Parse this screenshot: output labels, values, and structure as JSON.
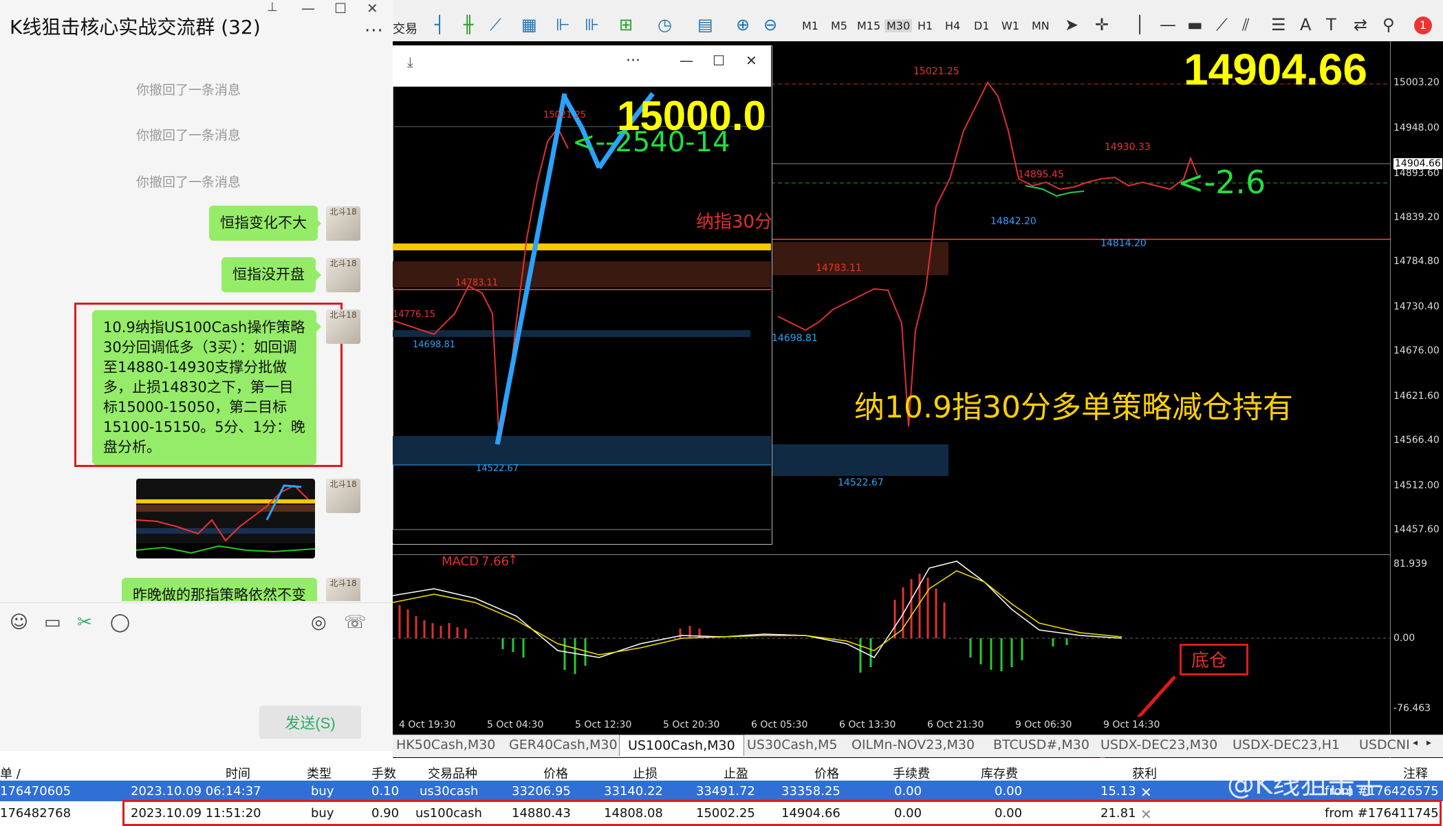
{
  "chat": {
    "title": "K线狙击核心实战交流群 (32)",
    "recalls": [
      "你撤回了一条消息",
      "你撤回了一条消息",
      "你撤回了一条消息"
    ],
    "messages": [
      "恒指变化不大",
      "恒指没开盘",
      "10.9纳指US100Cash操作策略30分回调低多（3买）：如回调至14880-14930支撑分批做多，止损14830之下，第一目标15000-15050，第二目标15100-15150。5分、1分：晚盘分析。",
      "昨晚做的那指策略依然不变"
    ],
    "avatar_text": "北斗18",
    "send_label": "发送(S)"
  },
  "platform": {
    "menu_trade": "交易",
    "timeframes": [
      "M1",
      "M5",
      "M15",
      "M30",
      "H1",
      "H4",
      "D1",
      "W1",
      "MN"
    ],
    "notify_count": "1",
    "big_price": "14904.66",
    "inner_big": "15000.0",
    "inner_arrow": "<--2540-14",
    "inner_label": "纳指30分",
    "arrow_label": "<-2.6",
    "strategy_text": "纳10.9指30分多单策略减仓持有",
    "bottom_label": "底仓",
    "macd_label": "MACD",
    "macd_value": "7.66",
    "chart_marks": {
      "high": "15021.25",
      "p1": "14930.33",
      "p2": "14895.45",
      "p3": "14842.20",
      "p4": "14814.20",
      "p5": "14783.11",
      "p6": "14698.81",
      "p7": "14522.67",
      "inner_high": "15021.25",
      "inner_p5": "14783.11",
      "inner_p6": "14698.81",
      "inner_p7": "14522.67",
      "inner_p8": "14776.15"
    },
    "price_ticks": [
      "15003.20",
      "14948.00",
      "14904.66",
      "14893.60",
      "14839.20",
      "14784.80",
      "14730.40",
      "14676.00",
      "14621.60",
      "14566.40",
      "14512.00",
      "14457.60"
    ],
    "macd_ticks": [
      "81.939",
      "0.00",
      "-76.463"
    ],
    "time_ticks": [
      "4 Oct 19:30",
      "5 Oct 04:30",
      "5 Oct 12:30",
      "5 Oct 20:30",
      "6 Oct 05:30",
      "6 Oct 13:30",
      "6 Oct 21:30",
      "9 Oct 06:30",
      "9 Oct 14:30"
    ],
    "symbol_tabs": [
      "HK50Cash,M30",
      "GER40Cash,M30",
      "US100Cash,M30",
      "US30Cash,M5",
      "OILMn-NOV23,M30",
      "BTCUSD#,M30",
      "USDX-DEC23,M30",
      "USDX-DEC23,H1",
      "USDCNI"
    ],
    "active_tab": "US100Cash,M30"
  },
  "orders": {
    "headers": [
      "单 /",
      "时间",
      "类型",
      "手数",
      "交易品种",
      "价格",
      "止损",
      "止盈",
      "价格",
      "手续费",
      "库存费",
      "获利",
      "注释"
    ],
    "rows": [
      [
        "176470605",
        "2023.10.09 06:14:37",
        "buy",
        "0.10",
        "us30cash",
        "33206.95",
        "33140.22",
        "33491.72",
        "33358.25",
        "0.00",
        "0.00",
        "15.13",
        "from #176426575"
      ],
      [
        "176482768",
        "2023.10.09 11:51:20",
        "buy",
        "0.90",
        "us100cash",
        "14880.43",
        "14808.08",
        "15002.25",
        "14904.66",
        "0.00",
        "0.00",
        "21.81",
        "from #176411745"
      ]
    ]
  },
  "watermark": "@K线狙击手"
}
